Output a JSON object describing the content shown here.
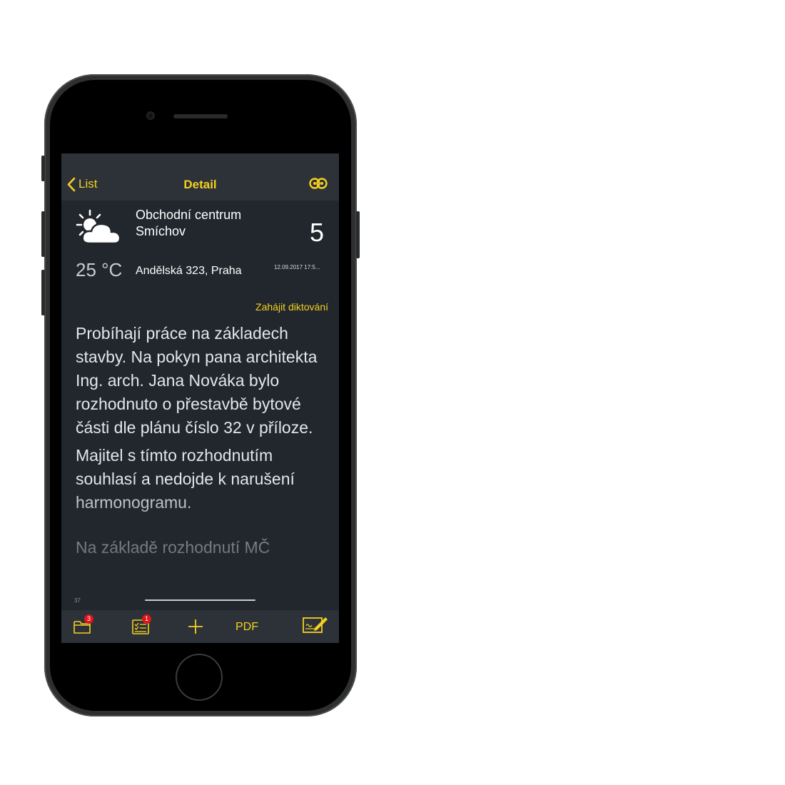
{
  "navbar": {
    "back_label": "List",
    "title": "Detail",
    "sync_icon": "infinity-link-icon"
  },
  "entry": {
    "location_name": "Obchodní centrum Smíchov",
    "number": "5",
    "temperature": "25 °C",
    "address": "Andělská 323, Praha",
    "datetime": "12.09.2017 17:5...",
    "weather_icon": "partly-cloudy-icon",
    "dictate_label": "Zahájit diktování",
    "paragraphs": [
      "Probíhají práce na základech stavby. Na pokyn pana architekta Ing. arch. Jana Nováka bylo rozhodnuto o přestavbě bytové části dle plánu číslo 32 v příloze.",
      "Majitel s tímto rozhodnutím souhlasí a nedojde k narušení harmonogramu.",
      "Na základě rozhodnutí MČ"
    ],
    "char_count": "37"
  },
  "toolbar": {
    "folder_badge": "3",
    "checklist_badge": "1",
    "pdf_label": "PDF"
  },
  "colors": {
    "accent": "#f5d020",
    "screen_bg": "#22272d",
    "bar_bg": "#2d3238",
    "badge": "#e0141e"
  }
}
